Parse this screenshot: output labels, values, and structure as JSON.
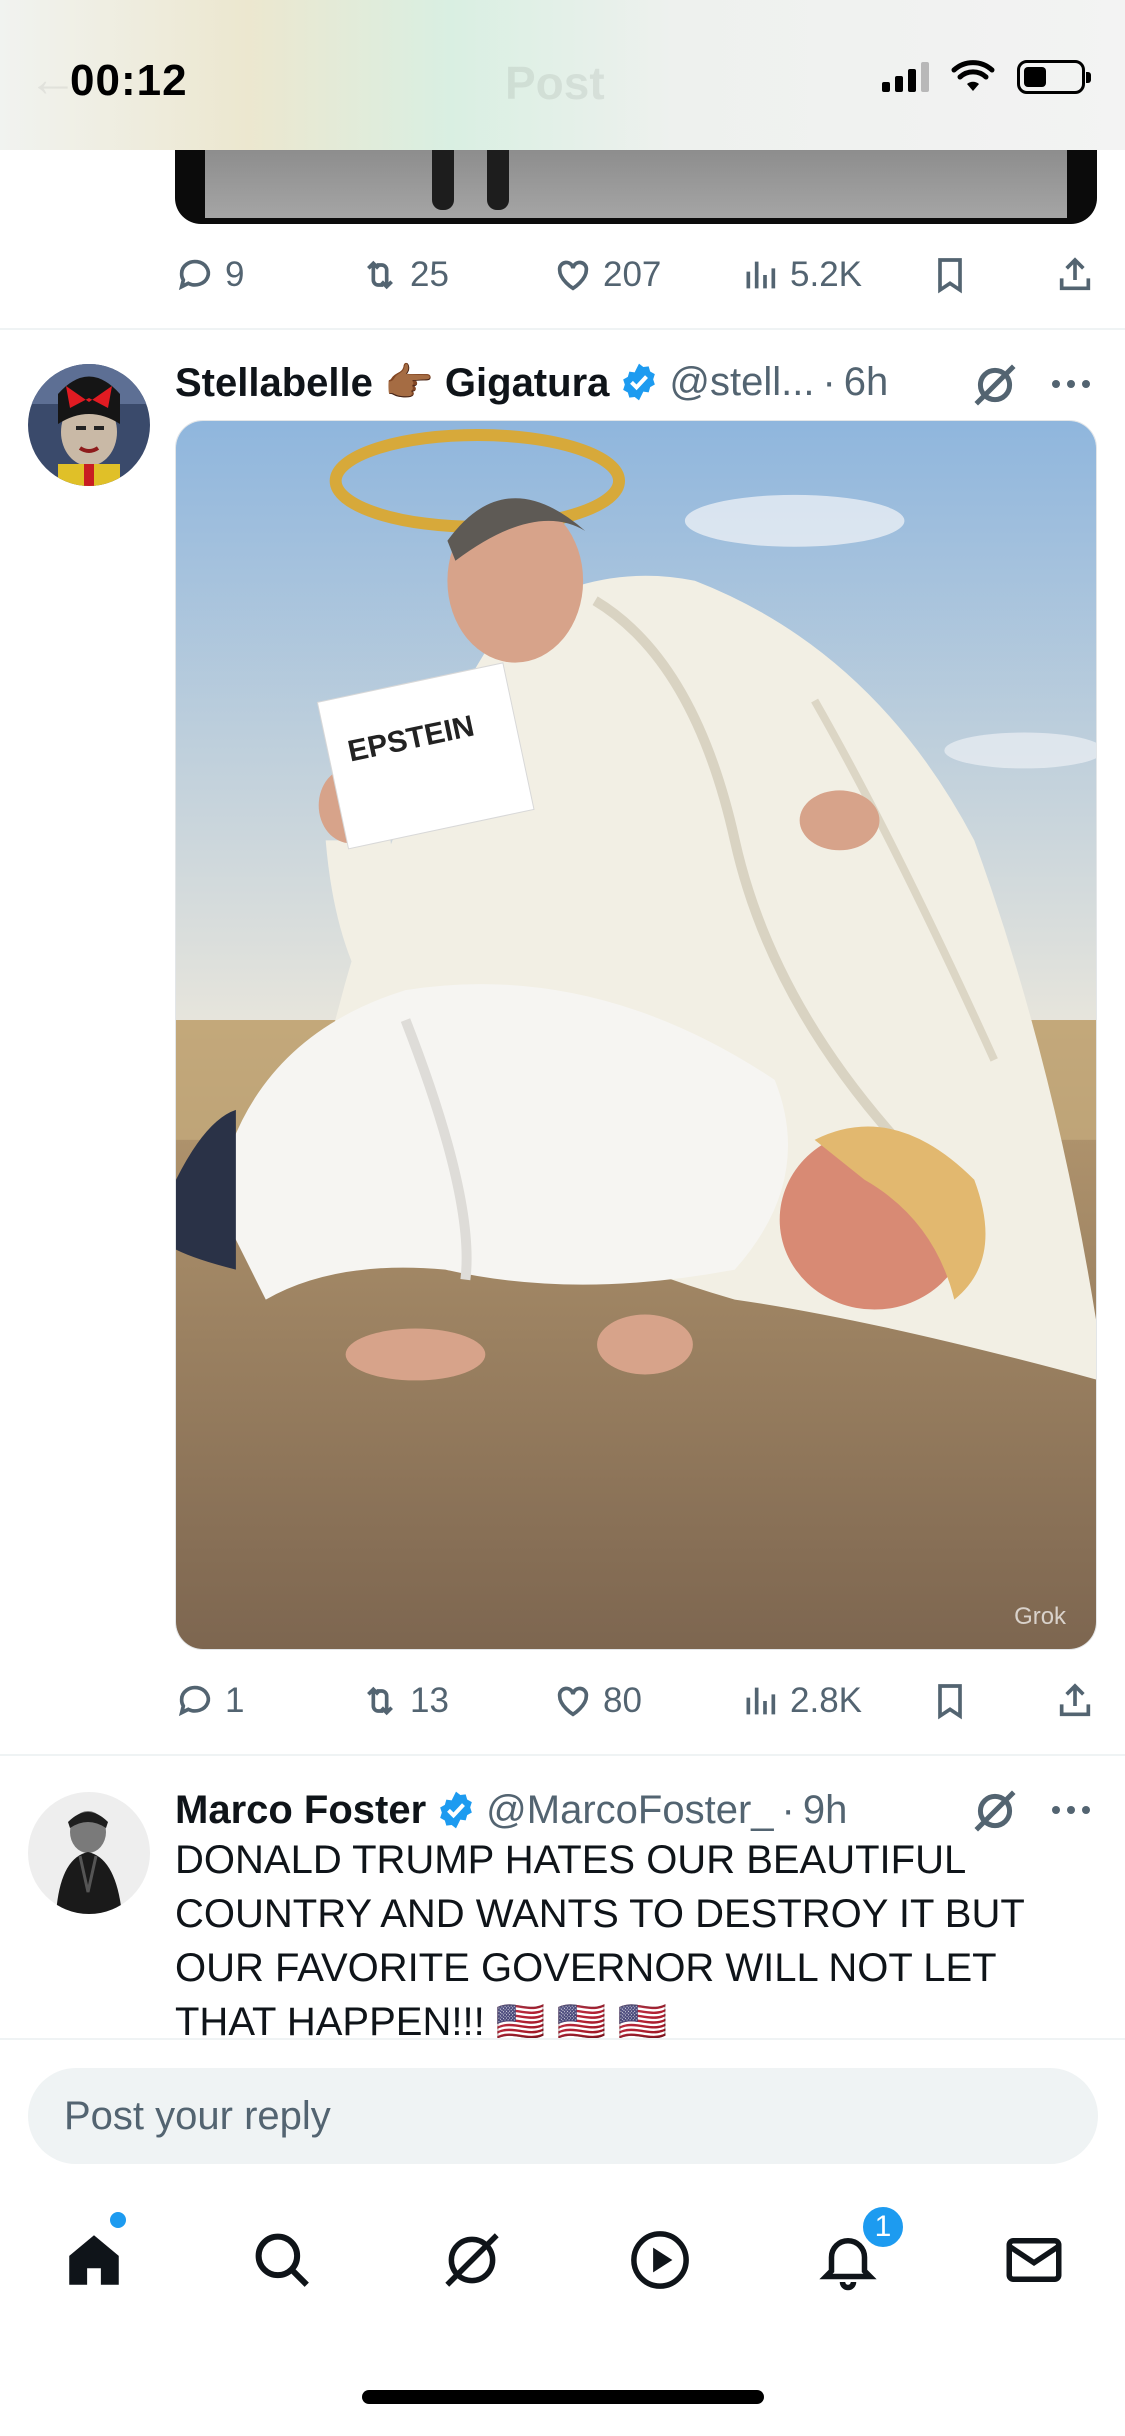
{
  "status_bar": {
    "time": "00:12",
    "header_title_faded": "Post"
  },
  "previous_tweet": {
    "actions": {
      "replies": "9",
      "reposts": "25",
      "likes": "207",
      "views": "5.2K"
    }
  },
  "tweet1": {
    "name": "Stellabelle 👉🏾 Gigatura",
    "handle": "@stell...",
    "separator": "·",
    "time": "6h",
    "image_sign_text": "EPSTEIN",
    "image_watermark": "Grok",
    "actions": {
      "replies": "1",
      "reposts": "13",
      "likes": "80",
      "views": "2.8K"
    }
  },
  "tweet2": {
    "name": "Marco Foster",
    "handle": "@MarcoFoster_",
    "separator": "·",
    "time": "9h",
    "text": "DONALD TRUMP HATES OUR BEAUTIFUL COUNTRY AND WANTS TO DESTROY IT BUT OUR FAVORITE GOVERNOR WILL NOT LET THAT HAPPEN!!! 🇺🇸 🇺🇸 🇺🇸"
  },
  "reply": {
    "placeholder": "Post your reply"
  },
  "tabbar": {
    "notifications_badge": "1",
    "accent_color": "#1d9bf0"
  },
  "colors": {
    "verified": "#1d9bf0",
    "muted": "#536471",
    "text": "#0f1419"
  }
}
